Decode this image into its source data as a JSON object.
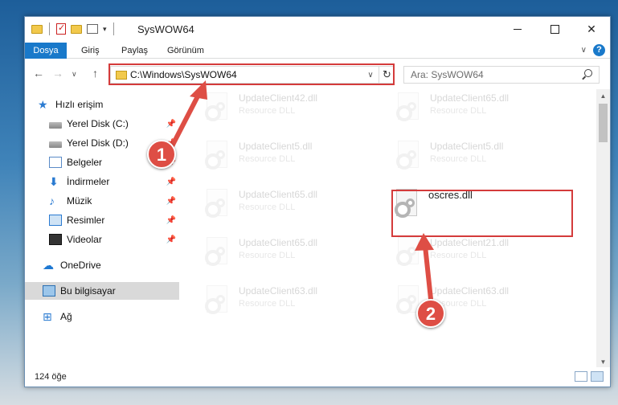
{
  "window": {
    "title": "SysWOW64",
    "caption_close": "✕"
  },
  "ribbon": {
    "tabs": [
      "Dosya",
      "Giriş",
      "Paylaş",
      "Görünüm"
    ],
    "collapse_chevron": "∨",
    "help": "?"
  },
  "navigation": {
    "back": "←",
    "forward": "→",
    "up": "↑",
    "recent": "∨",
    "address": "C:\\Windows\\SysWOW64",
    "address_chevron": "∨",
    "refresh": "↻",
    "search_placeholder": "Ara: SysWOW64"
  },
  "sidebar": {
    "items": [
      {
        "label": "Hızlı erişim",
        "icon": "star-icon",
        "pinned": false
      },
      {
        "label": "Yerel Disk (C:)",
        "icon": "drive-icon",
        "pinned": true
      },
      {
        "label": "Yerel Disk (D:)",
        "icon": "drive-icon",
        "pinned": true
      },
      {
        "label": "Belgeler",
        "icon": "documents-icon",
        "pinned": true
      },
      {
        "label": "İndirmeler",
        "icon": "downloads-icon",
        "pinned": true
      },
      {
        "label": "Müzik",
        "icon": "music-icon",
        "pinned": true
      },
      {
        "label": "Resimler",
        "icon": "pictures-icon",
        "pinned": true
      },
      {
        "label": "Videolar",
        "icon": "videos-icon",
        "pinned": true
      },
      {
        "label": "OneDrive",
        "icon": "onedrive-icon",
        "pinned": false
      },
      {
        "label": "Bu bilgisayar",
        "icon": "computer-icon",
        "pinned": false,
        "selected": true
      },
      {
        "label": "Ağ",
        "icon": "network-icon",
        "pinned": false
      }
    ]
  },
  "files": [
    {
      "name": "UpdateClient42.dll",
      "type": "Resource DLL"
    },
    {
      "name": "UpdateClient65.dll",
      "type": "Resource DLL"
    },
    {
      "name": "UpdateClient5.dll",
      "type": "Resource DLL"
    },
    {
      "name": "UpdateClient5.dll",
      "type": "Resource DLL"
    },
    {
      "name": "UpdateClient65.dll",
      "type": "Resource DLL"
    },
    {
      "name": "oscres.dll",
      "type": ""
    },
    {
      "name": "UpdateClient65.dll",
      "type": "Resource DLL"
    },
    {
      "name": "UpdateClient21.dll",
      "type": "Resource DLL"
    },
    {
      "name": "UpdateClient63.dll",
      "type": "Resource DLL"
    },
    {
      "name": "UpdateClient63.dll",
      "type": "Resource DLL"
    }
  ],
  "status": {
    "item_count": "124 öğe"
  },
  "annotations": {
    "step1": "1",
    "step2": "2",
    "color": "#de4e45"
  }
}
